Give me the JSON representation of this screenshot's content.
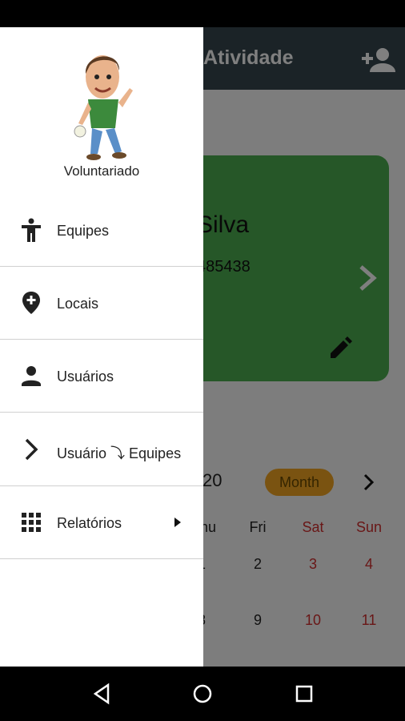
{
  "appbar": {
    "title": "Atividade",
    "add_user_icon": "person-add-icon"
  },
  "card": {
    "name_fragment": "Silva",
    "phone_fragment": "485438",
    "color": "#4caf50"
  },
  "calendar": {
    "year_fragment": "20",
    "view_chip": "Month",
    "weekdays": [
      "hu",
      "Fri",
      "Sat",
      "Sun"
    ],
    "row1": [
      "1",
      "2",
      "3",
      "4"
    ],
    "row2": [
      "8",
      "9",
      "10",
      "11"
    ],
    "weekend_color": "#d32f2f"
  },
  "drawer": {
    "header": "Voluntariado",
    "items": [
      {
        "label": "Equipes",
        "icon": "accessibility-icon"
      },
      {
        "label": "Locais",
        "icon": "add-location-icon"
      },
      {
        "label": "Usuários",
        "icon": "person-icon"
      },
      {
        "label": "Usuário ⤵ Equipes",
        "icon": "chevron-right-icon"
      },
      {
        "label": "Relatórios",
        "icon": "grid-icon"
      }
    ]
  }
}
